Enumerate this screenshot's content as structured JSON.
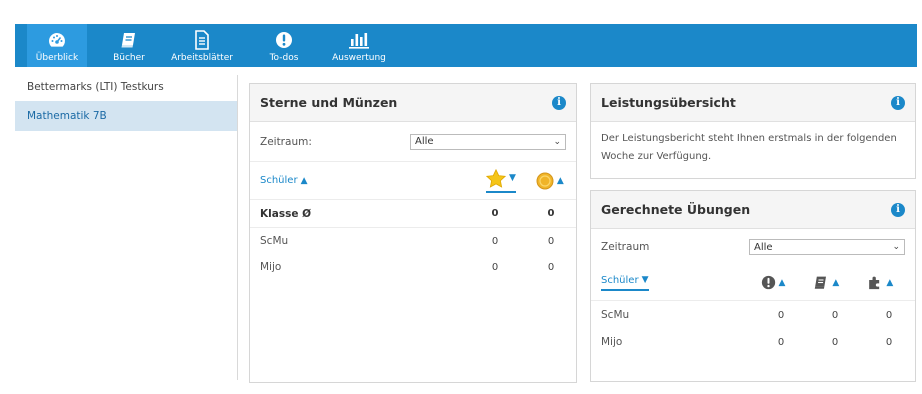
{
  "nav": {
    "items": [
      {
        "label": "Überblick",
        "icon": "dashboard-icon"
      },
      {
        "label": "Bücher",
        "icon": "book-icon"
      },
      {
        "label": "Arbeitsblätter",
        "icon": "worksheet-icon"
      },
      {
        "label": "To-dos",
        "icon": "alert-icon"
      },
      {
        "label": "Auswertung",
        "icon": "bar-chart-icon"
      }
    ],
    "accent": "#1b88c9"
  },
  "sidebar": {
    "items": [
      {
        "label": "Bettermarks (LTI) Testkurs"
      },
      {
        "label": "Mathematik 7B"
      }
    ]
  },
  "stars_panel": {
    "title": "Sterne und Münzen",
    "period_label": "Zeitraum:",
    "period_value": "Alle",
    "student_header": "Schüler",
    "rows": [
      {
        "name": "Klasse Ø",
        "stars": "0",
        "coins": "0"
      },
      {
        "name": "ScMu",
        "stars": "0",
        "coins": "0"
      },
      {
        "name": "Mijo",
        "stars": "0",
        "coins": "0"
      }
    ]
  },
  "performance_panel": {
    "title": "Leistungsübersicht",
    "text": "Der Leistungsbericht steht Ihnen erstmals in der folgenden Woche zur Verfügung."
  },
  "exercises_panel": {
    "title": "Gerechnete Übungen",
    "period_label": "Zeitraum",
    "period_value": "Alle",
    "student_header": "Schüler",
    "rows": [
      {
        "name": "ScMu",
        "c1": "0",
        "c2": "0",
        "c3": "0"
      },
      {
        "name": "Mijo",
        "c1": "0",
        "c2": "0",
        "c3": "0"
      }
    ]
  }
}
